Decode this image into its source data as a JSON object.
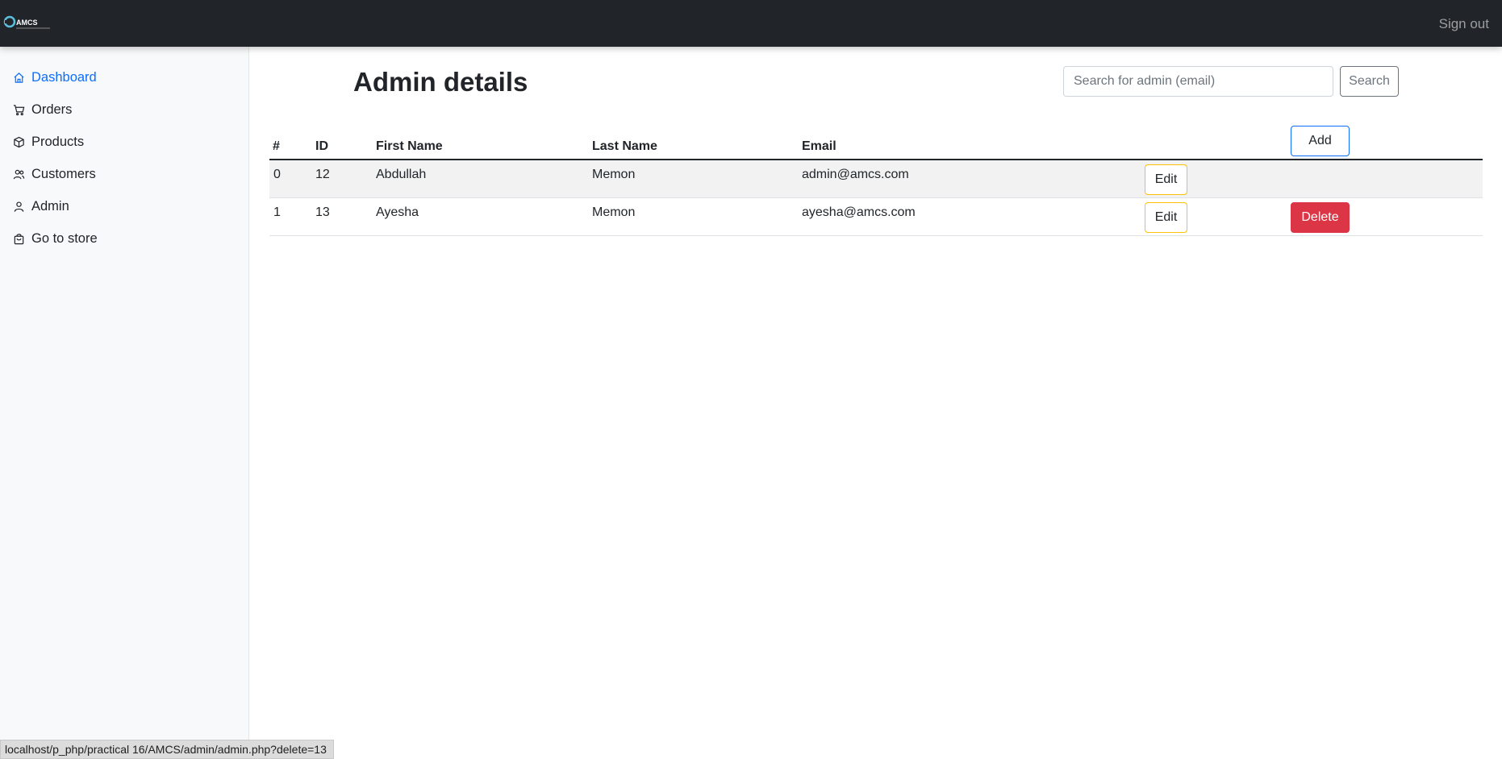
{
  "brand": {
    "logo_text": "AMCS"
  },
  "topbar": {
    "signout_label": "Sign out"
  },
  "sidebar": {
    "items": [
      {
        "label": "Dashboard",
        "icon": "home-icon",
        "active": true
      },
      {
        "label": "Orders",
        "icon": "cart-icon"
      },
      {
        "label": "Products",
        "icon": "box-icon"
      },
      {
        "label": "Customers",
        "icon": "users-icon"
      },
      {
        "label": "Admin",
        "icon": "user-icon"
      },
      {
        "label": "Go to store",
        "icon": "shopping-bag-icon"
      }
    ]
  },
  "main": {
    "title": "Admin details",
    "search": {
      "placeholder": "Search for admin (email)",
      "value": "",
      "button_label": "Search"
    },
    "add_label": "Add",
    "table": {
      "columns": [
        "#",
        "ID",
        "First Name",
        "Last Name",
        "Email"
      ],
      "rows": [
        {
          "index": "0",
          "id": "12",
          "first_name": "Abdullah",
          "last_name": "Memon",
          "email": "admin@amcs.com",
          "edit_label": "Edit"
        },
        {
          "index": "1",
          "id": "13",
          "first_name": "Ayesha",
          "last_name": "Memon",
          "email": "ayesha@amcs.com",
          "edit_label": "Edit",
          "delete_label": "Delete"
        }
      ]
    }
  },
  "statusbar": {
    "url": "localhost/p_php/practical 16/AMCS/admin/admin.php?delete=13"
  },
  "colors": {
    "navbar_bg": "#212529",
    "sidebar_bg": "#f8f9fa",
    "active_link": "#0d6efd",
    "edit_border": "#ffc107",
    "delete_bg": "#dc3545",
    "add_border": "#0d6efd"
  }
}
